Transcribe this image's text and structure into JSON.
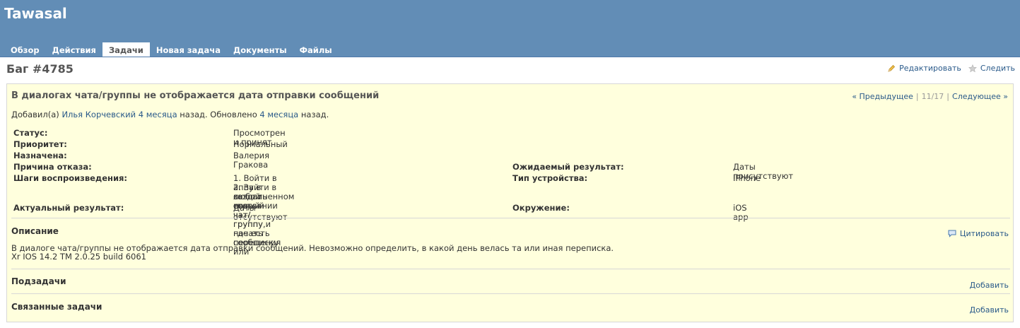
{
  "app": {
    "title": "Tawasal"
  },
  "menu": {
    "tabs": [
      {
        "label": "Обзор"
      },
      {
        "label": "Действия"
      },
      {
        "label": "Задачи"
      },
      {
        "label": "Новая задача"
      },
      {
        "label": "Документы"
      },
      {
        "label": "Файлы"
      }
    ],
    "selected": "Задачи"
  },
  "issue": {
    "title": "Баг #4785",
    "edit_label": "Редактировать",
    "watch_label": "Следить",
    "subject": "В диалогах чата/группы не отображается дата отправки сообщений",
    "nav": {
      "prev": "« Предыдущее",
      "position": "11/17",
      "next": "Следующее »"
    },
    "author_prefix": "Добавил(а)",
    "author_name": "Илья Корчевский",
    "created_ago": "4 месяца",
    "created_suffix": "назад. Обновлено",
    "updated_ago": "4 месяца",
    "updated_suffix": "назад.",
    "attributes": {
      "status": {
        "label": "Статус:",
        "value": "Просмотрен и принят"
      },
      "priority": {
        "label": "Приоритет:",
        "value": "Нормальный"
      },
      "assignee": {
        "label": "Назначена:",
        "value": "Валерия Гракова"
      },
      "reject_reason": {
        "label": "Причина отказа:",
        "value": ""
      },
      "steps": {
        "label": "Шаги воспроизведения:",
        "line1": "1. Войти в аппу в залогиненном состоянии",
        "line2": "2. Зайти в любой старый чат/группу, где есть сообщения или",
        "line3": "создать новый чат/группу и начать переписку"
      },
      "actual": {
        "label": "Актуальный результат:",
        "value": "Даты отсутствуют"
      },
      "expected": {
        "label": "Ожидаемый результат:",
        "value": "Даты присутствуют"
      },
      "device": {
        "label": "Тип устройства:",
        "value": "IPhone"
      },
      "environment": {
        "label": "Окружение:",
        "value": "iOS app"
      }
    },
    "description": {
      "title": "Описание",
      "quote_label": "Цитировать",
      "line1": "В диалоге чата/группы не отображается дата отправки сообщений. Невозможно определить, в какой день велась та или иная переписка.",
      "line2": "Xr IOS 14.2 TM 2.0.25 build 6061"
    },
    "subtasks": {
      "title": "Подзадачи",
      "add_label": "Добавить"
    },
    "relations": {
      "title": "Связанные задачи",
      "add_label": "Добавить"
    }
  },
  "icons": {
    "edit": "pencil-icon",
    "watch": "star-icon",
    "quote": "comment-icon"
  },
  "colors": {
    "header_bg": "#628db6",
    "issue_bg": "#ffffdd",
    "link": "#2a5a8a"
  }
}
